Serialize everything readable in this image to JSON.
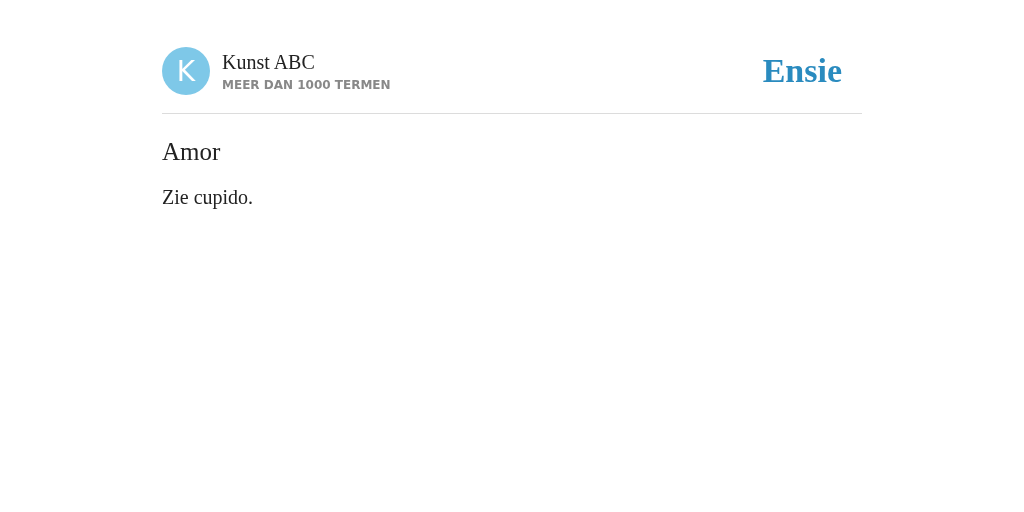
{
  "header": {
    "avatar_letter": "K",
    "title": "Kunst ABC",
    "subtitle": "MEER DAN 1000 TERMEN",
    "logo": "Ensie"
  },
  "entry": {
    "term": "Amor",
    "definition": "Zie cupido."
  }
}
